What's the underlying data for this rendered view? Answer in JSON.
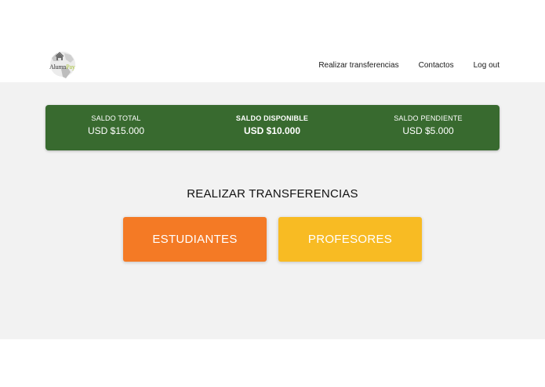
{
  "brand": {
    "logo_text_a": "Alumn",
    "logo_text_b": "Pay"
  },
  "nav": {
    "items": [
      {
        "label": "Realizar transferencias"
      },
      {
        "label": "Contactos"
      },
      {
        "label": "Log out"
      }
    ]
  },
  "balance": {
    "total": {
      "label": "SALDO TOTAL",
      "value": "USD $15.000"
    },
    "disponible": {
      "label": "SALDO DISPONIBLE",
      "value": "USD $10.000"
    },
    "pendiente": {
      "label": "SALDO PENDIENTE",
      "value": "USD $5.000"
    }
  },
  "main": {
    "title": "REALIZAR TRANSFERENCIAS",
    "buttons": [
      {
        "label": "ESTUDIANTES"
      },
      {
        "label": "PROFESORES"
      }
    ]
  },
  "colors": {
    "balance_bg": "#386a2f",
    "estudiantes": "#f47a25",
    "profesores": "#f8bb23",
    "content_bg": "#f2f2f2"
  }
}
